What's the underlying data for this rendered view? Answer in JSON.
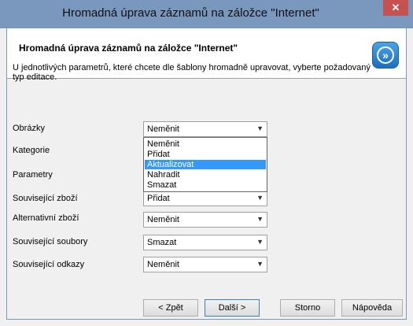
{
  "window": {
    "title": "Hromadná úprava záznamů na záložce \"Internet\"",
    "close_glyph": "✕"
  },
  "header": {
    "title": "Hromadná úprava záznamů na záložce \"Internet\"",
    "icon": "wizard-icon",
    "icon_glyph": "»"
  },
  "instructions": "U jednotlivých parametrů, které chcete dle šablony hromadně upravovat, vyberte požadovaný typ editace.",
  "rows": [
    {
      "label": "Obrázky",
      "value": "Neměnit"
    },
    {
      "label": "Kategorie",
      "value": ""
    },
    {
      "label": "Parametry",
      "value": ""
    },
    {
      "label": "Související zboží",
      "value": "Přidat"
    },
    {
      "label": "Alternativní zboží",
      "value": "Neměnit"
    },
    {
      "label": "Související soubory",
      "value": "Smazat"
    },
    {
      "label": "Související odkazy",
      "value": "Neměnit"
    }
  ],
  "dropdown": {
    "options": [
      "Neměnit",
      "Přidat",
      "Aktualizovat",
      "Nahradit",
      "Smazat"
    ],
    "highlighted": "Aktualizovat"
  },
  "buttons": {
    "back": "< Zpět",
    "next": "Další >",
    "cancel": "Storno",
    "help": "Nápověda"
  },
  "colors": {
    "titlebar": "#7a97be",
    "close": "#c75050",
    "highlight": "#3399ff"
  }
}
